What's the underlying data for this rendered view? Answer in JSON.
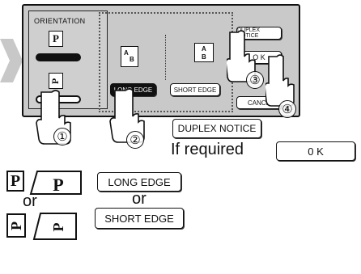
{
  "panel": {
    "orientation_label": "ORIENTATION",
    "long_edge_label": "LONG EDGE",
    "short_edge_label": "SHORT EDGE",
    "duplex_notice_label": "DUPLEX NOTICE",
    "ok_label": "O K",
    "cancel_label": "CANCE"
  },
  "steps": [
    "①",
    "②",
    "③",
    "④"
  ],
  "callout": {
    "duplex_notice_label": "DUPLEX NOTICE",
    "if_required_text": "If required",
    "ok_label": "0 K"
  },
  "legend": {
    "or_text_1": "or",
    "or_text_2": "or",
    "long_edge_label": "LONG EDGE",
    "short_edge_label": "SHORT EDGE",
    "portrait_glyph": "P",
    "landscape_glyph": "P"
  },
  "colors": {
    "panel_bg": "#c9c9c9",
    "arrow_bg": "#c8c8c8",
    "selected_button_bg": "#111111"
  }
}
